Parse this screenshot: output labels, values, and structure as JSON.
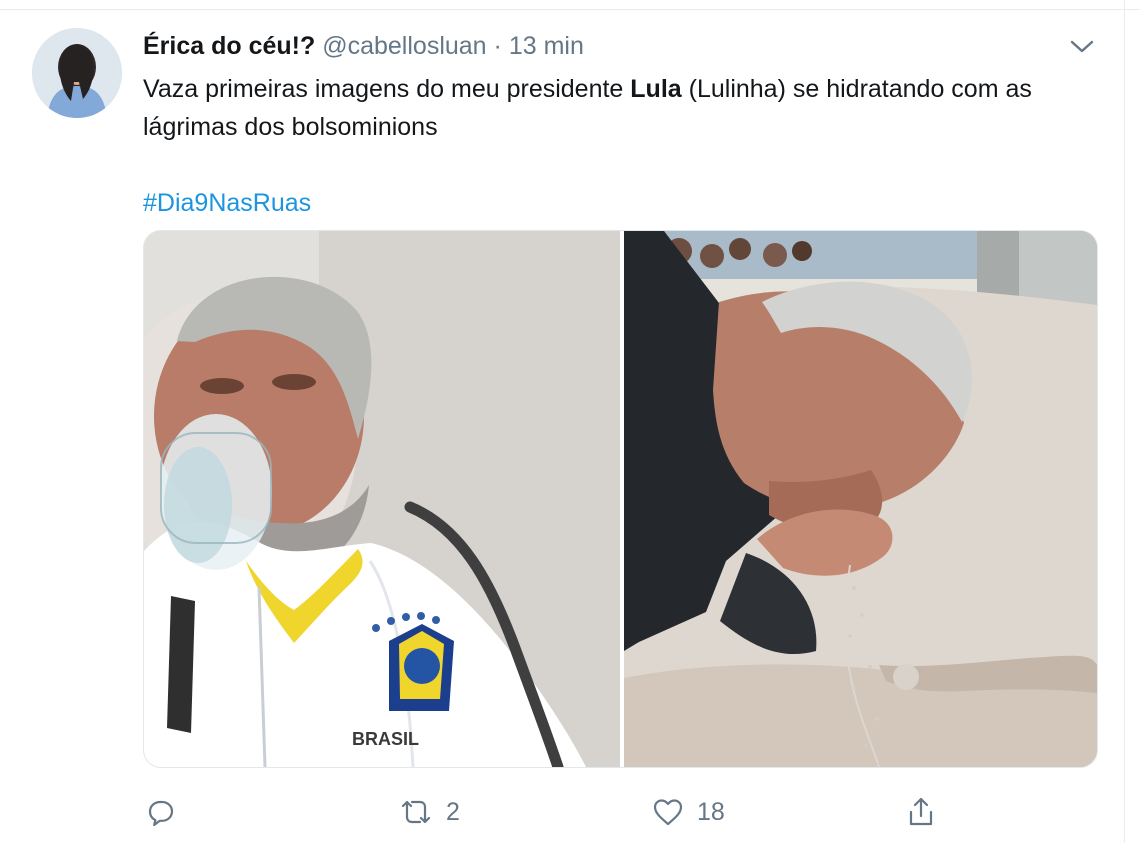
{
  "tweet": {
    "author_name": "Érica do céu!?",
    "handle": "@cabellosluan",
    "separator": "·",
    "time": "13 min",
    "text_before": "Vaza primeiras imagens do meu presidente ",
    "text_bold": "Lula",
    "text_after": " (Lulinha) se hidratando com as lágrimas dos bolsominions",
    "hashtag": "#Dia9NasRuas",
    "jersey_text": "BRASIL"
  },
  "actions": {
    "reply_icon": "reply-icon",
    "retweet_icon": "retweet-icon",
    "retweet_count": "2",
    "like_icon": "heart-icon",
    "like_count": "18",
    "share_icon": "share-icon"
  },
  "colors": {
    "link": "#1b95e0",
    "muted": "#657786",
    "text": "#14171a"
  }
}
